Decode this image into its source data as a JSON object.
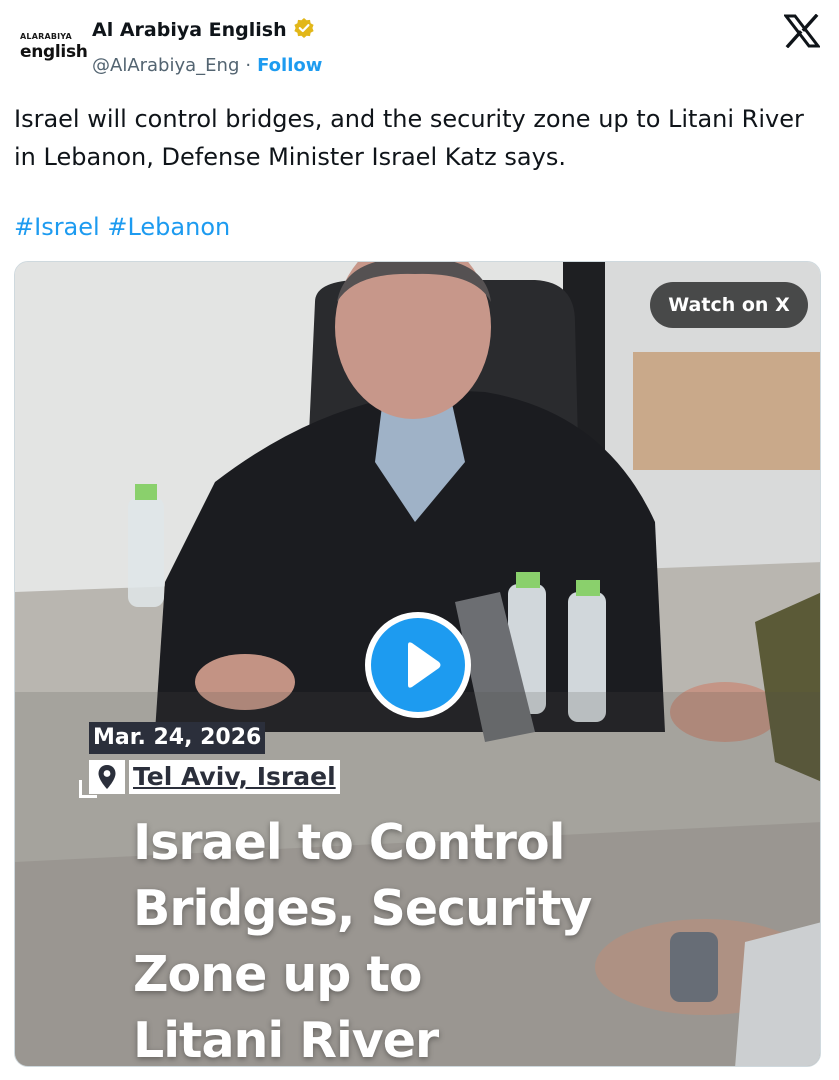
{
  "account": {
    "avatar_line1": "ALARABIYA",
    "avatar_line2": "english",
    "display_name": "Al Arabiya English",
    "verified_icon": "verified-badge-icon",
    "handle": "@AlArabiya_Eng",
    "separator": "·",
    "follow_label": "Follow"
  },
  "platform_icon": "x-logo-icon",
  "tweet": {
    "text": "Israel will control bridges, and the security zone up to Litani River in Lebanon, Defense Minister Israel Katz says.",
    "hashtags": [
      "#Israel",
      "#Lebanon"
    ]
  },
  "media": {
    "watch_label": "Watch on X",
    "play_icon": "play-icon",
    "date": "Mar. 24, 2026",
    "location_icon": "location-pin-icon",
    "location": "Tel Aviv, Israel",
    "headline_lines": [
      "Israel to Control",
      "Bridges, Security",
      "Zone up to",
      "Litani River"
    ]
  },
  "colors": {
    "link": "#1d9bf0",
    "verified_gold": "#e2b719",
    "label_dark": "#2b2f3b"
  }
}
